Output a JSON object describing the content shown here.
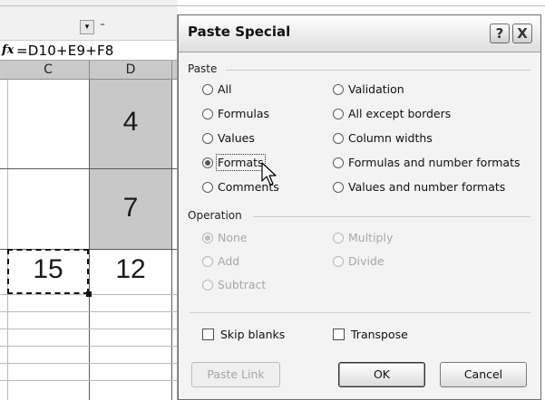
{
  "spreadsheet": {
    "formula_bar": {
      "fx_symbol": "fx",
      "formula": "=D10+E9+F8"
    },
    "columns": [
      "C",
      "D"
    ],
    "cells": {
      "d_row1": "4",
      "d_row2": "7",
      "c_result": "15",
      "d_result": "12"
    }
  },
  "dialog": {
    "title": "Paste Special",
    "help_label": "?",
    "close_label": "X",
    "paste_group": {
      "label": "Paste",
      "left_options": [
        "All",
        "Formulas",
        "Values",
        "Formats",
        "Comments"
      ],
      "right_options": [
        "Validation",
        "All except borders",
        "Column widths",
        "Formulas and number formats",
        "Values and number formats"
      ],
      "selected": "Formats"
    },
    "operation_group": {
      "label": "Operation",
      "left_options": [
        "None",
        "Add",
        "Subtract"
      ],
      "right_options": [
        "Multiply",
        "Divide"
      ],
      "selected": "None"
    },
    "checkboxes": {
      "skip_blanks": "Skip blanks",
      "transpose": "Transpose"
    },
    "buttons": {
      "paste_link": "Paste Link",
      "ok": "OK",
      "cancel": "Cancel"
    }
  }
}
